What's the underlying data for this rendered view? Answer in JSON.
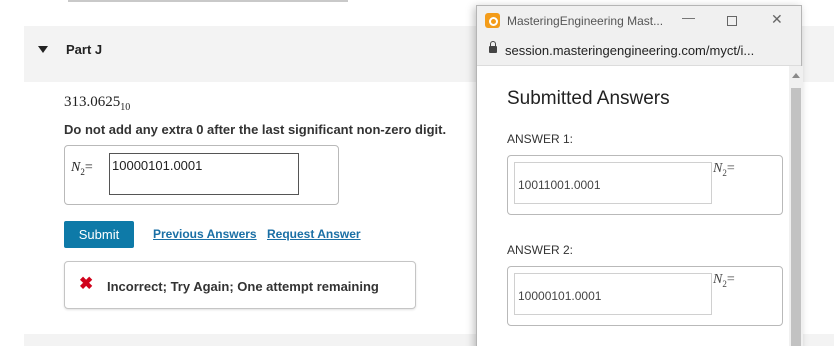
{
  "page": {
    "part_title": "Part J",
    "value": {
      "number": "313.0625",
      "base": "10"
    },
    "instruction": "Do not add any extra 0 after the last significant non-zero digit.",
    "answer": {
      "variable": "N",
      "subscript": "2",
      "equals": "=",
      "input_value": "10000101.0001"
    },
    "submit_label": "Submit",
    "previous_answers_label": "Previous Answers",
    "request_answer_label": "Request Answer",
    "feedback_text": "Incorrect; Try Again; One attempt remaining"
  },
  "popup": {
    "window_title": "MasteringEngineering Mast...",
    "url": "session.masteringengineering.com/myct/i...",
    "heading": "Submitted Answers",
    "answers": [
      {
        "label": "ANSWER 1:",
        "value": "10011001.0001",
        "variable": "N",
        "subscript": "2",
        "equals": "="
      },
      {
        "label": "ANSWER 2:",
        "value": "10000101.0001",
        "variable": "N",
        "subscript": "2",
        "equals": "="
      }
    ]
  },
  "icons": {
    "caret": "caret-down-icon",
    "incorrect": "x-mark-icon",
    "lock": "lock-icon",
    "app": "mastering-app-icon"
  },
  "colors": {
    "submit_bg": "#0e7aa8",
    "link": "#1a6fa5",
    "error": "#d0021b",
    "app_icon": "#f39c1a"
  }
}
